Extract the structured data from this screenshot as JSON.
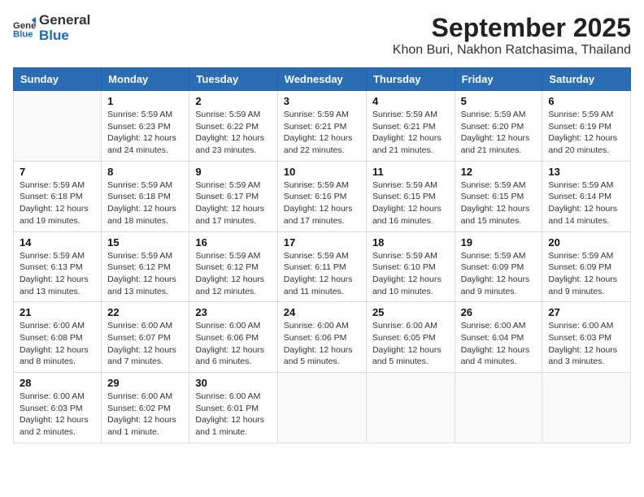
{
  "header": {
    "logo_general": "General",
    "logo_blue": "Blue",
    "month_title": "September 2025",
    "location": "Khon Buri, Nakhon Ratchasima, Thailand"
  },
  "weekdays": [
    "Sunday",
    "Monday",
    "Tuesday",
    "Wednesday",
    "Thursday",
    "Friday",
    "Saturday"
  ],
  "weeks": [
    [
      {
        "day": "",
        "info": ""
      },
      {
        "day": "1",
        "info": "Sunrise: 5:59 AM\nSunset: 6:23 PM\nDaylight: 12 hours\nand 24 minutes."
      },
      {
        "day": "2",
        "info": "Sunrise: 5:59 AM\nSunset: 6:22 PM\nDaylight: 12 hours\nand 23 minutes."
      },
      {
        "day": "3",
        "info": "Sunrise: 5:59 AM\nSunset: 6:21 PM\nDaylight: 12 hours\nand 22 minutes."
      },
      {
        "day": "4",
        "info": "Sunrise: 5:59 AM\nSunset: 6:21 PM\nDaylight: 12 hours\nand 21 minutes."
      },
      {
        "day": "5",
        "info": "Sunrise: 5:59 AM\nSunset: 6:20 PM\nDaylight: 12 hours\nand 21 minutes."
      },
      {
        "day": "6",
        "info": "Sunrise: 5:59 AM\nSunset: 6:19 PM\nDaylight: 12 hours\nand 20 minutes."
      }
    ],
    [
      {
        "day": "7",
        "info": "Sunrise: 5:59 AM\nSunset: 6:18 PM\nDaylight: 12 hours\nand 19 minutes."
      },
      {
        "day": "8",
        "info": "Sunrise: 5:59 AM\nSunset: 6:18 PM\nDaylight: 12 hours\nand 18 minutes."
      },
      {
        "day": "9",
        "info": "Sunrise: 5:59 AM\nSunset: 6:17 PM\nDaylight: 12 hours\nand 17 minutes."
      },
      {
        "day": "10",
        "info": "Sunrise: 5:59 AM\nSunset: 6:16 PM\nDaylight: 12 hours\nand 17 minutes."
      },
      {
        "day": "11",
        "info": "Sunrise: 5:59 AM\nSunset: 6:15 PM\nDaylight: 12 hours\nand 16 minutes."
      },
      {
        "day": "12",
        "info": "Sunrise: 5:59 AM\nSunset: 6:15 PM\nDaylight: 12 hours\nand 15 minutes."
      },
      {
        "day": "13",
        "info": "Sunrise: 5:59 AM\nSunset: 6:14 PM\nDaylight: 12 hours\nand 14 minutes."
      }
    ],
    [
      {
        "day": "14",
        "info": "Sunrise: 5:59 AM\nSunset: 6:13 PM\nDaylight: 12 hours\nand 13 minutes."
      },
      {
        "day": "15",
        "info": "Sunrise: 5:59 AM\nSunset: 6:12 PM\nDaylight: 12 hours\nand 13 minutes."
      },
      {
        "day": "16",
        "info": "Sunrise: 5:59 AM\nSunset: 6:12 PM\nDaylight: 12 hours\nand 12 minutes."
      },
      {
        "day": "17",
        "info": "Sunrise: 5:59 AM\nSunset: 6:11 PM\nDaylight: 12 hours\nand 11 minutes."
      },
      {
        "day": "18",
        "info": "Sunrise: 5:59 AM\nSunset: 6:10 PM\nDaylight: 12 hours\nand 10 minutes."
      },
      {
        "day": "19",
        "info": "Sunrise: 5:59 AM\nSunset: 6:09 PM\nDaylight: 12 hours\nand 9 minutes."
      },
      {
        "day": "20",
        "info": "Sunrise: 5:59 AM\nSunset: 6:09 PM\nDaylight: 12 hours\nand 9 minutes."
      }
    ],
    [
      {
        "day": "21",
        "info": "Sunrise: 6:00 AM\nSunset: 6:08 PM\nDaylight: 12 hours\nand 8 minutes."
      },
      {
        "day": "22",
        "info": "Sunrise: 6:00 AM\nSunset: 6:07 PM\nDaylight: 12 hours\nand 7 minutes."
      },
      {
        "day": "23",
        "info": "Sunrise: 6:00 AM\nSunset: 6:06 PM\nDaylight: 12 hours\nand 6 minutes."
      },
      {
        "day": "24",
        "info": "Sunrise: 6:00 AM\nSunset: 6:06 PM\nDaylight: 12 hours\nand 5 minutes."
      },
      {
        "day": "25",
        "info": "Sunrise: 6:00 AM\nSunset: 6:05 PM\nDaylight: 12 hours\nand 5 minutes."
      },
      {
        "day": "26",
        "info": "Sunrise: 6:00 AM\nSunset: 6:04 PM\nDaylight: 12 hours\nand 4 minutes."
      },
      {
        "day": "27",
        "info": "Sunrise: 6:00 AM\nSunset: 6:03 PM\nDaylight: 12 hours\nand 3 minutes."
      }
    ],
    [
      {
        "day": "28",
        "info": "Sunrise: 6:00 AM\nSunset: 6:03 PM\nDaylight: 12 hours\nand 2 minutes."
      },
      {
        "day": "29",
        "info": "Sunrise: 6:00 AM\nSunset: 6:02 PM\nDaylight: 12 hours\nand 1 minute."
      },
      {
        "day": "30",
        "info": "Sunrise: 6:00 AM\nSunset: 6:01 PM\nDaylight: 12 hours\nand 1 minute."
      },
      {
        "day": "",
        "info": ""
      },
      {
        "day": "",
        "info": ""
      },
      {
        "day": "",
        "info": ""
      },
      {
        "day": "",
        "info": ""
      }
    ]
  ]
}
